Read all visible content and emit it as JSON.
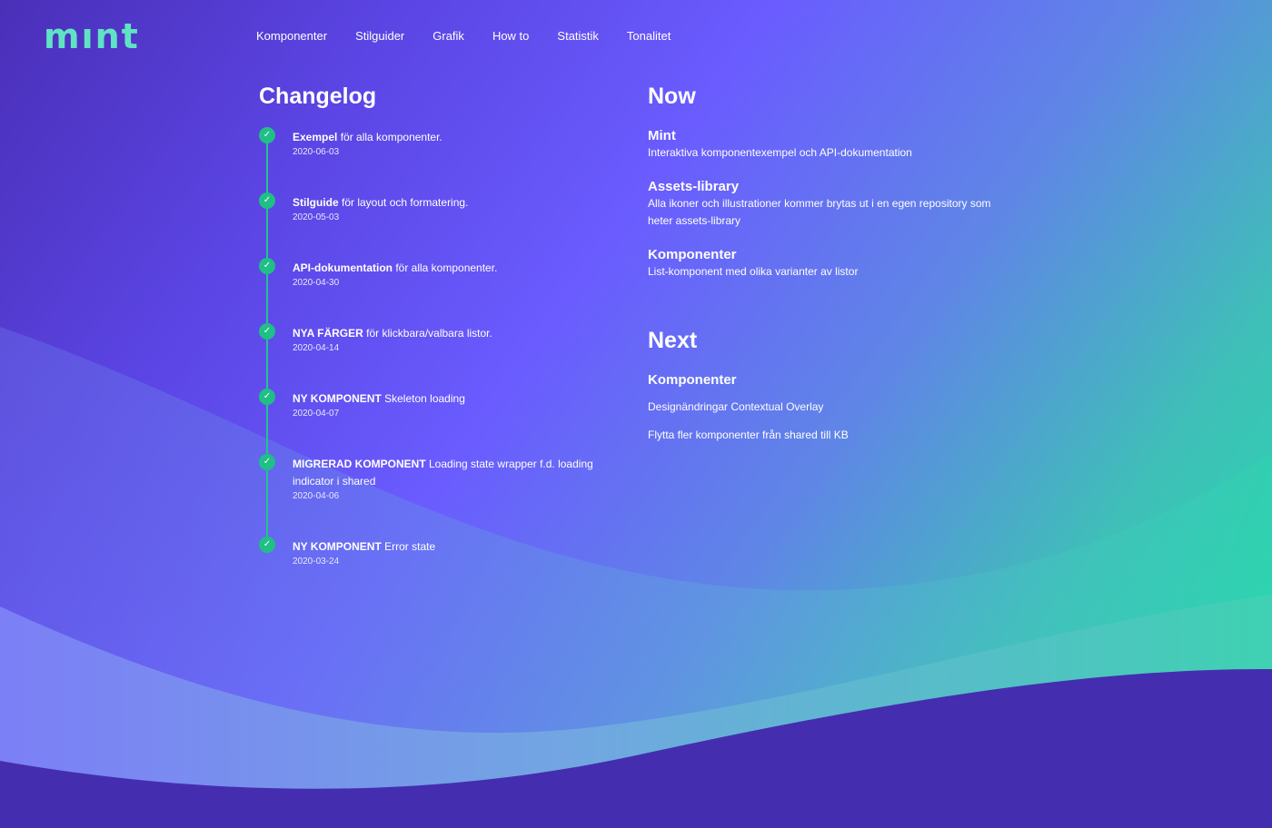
{
  "brand": {
    "logo_text": "mınt",
    "logo_color": "#5fe3c4"
  },
  "nav": {
    "items": [
      "Komponenter",
      "Stilguider",
      "Grafik",
      "How to",
      "Statistik",
      "Tonalitet"
    ]
  },
  "changelog": {
    "title": "Changelog",
    "items": [
      {
        "bold": "Exempel",
        "text": " för alla komponenter.",
        "date": "2020-06-03"
      },
      {
        "bold": "Stilguide",
        "text": " för layout och formatering.",
        "date": "2020-05-03"
      },
      {
        "bold": "API-dokumentation",
        "text": " för alla komponenter.",
        "date": "2020-04-30"
      },
      {
        "bold": "NYA FÄRGER",
        "text": " för klickbara/valbara listor.",
        "date": "2020-04-14"
      },
      {
        "bold": "NY KOMPONENT",
        "text": " Skeleton loading",
        "date": "2020-04-07"
      },
      {
        "bold": "MIGRERAD KOMPONENT",
        "text": " Loading state wrapper f.d. loading indicator i shared",
        "date": "2020-04-06"
      },
      {
        "bold": "NY KOMPONENT",
        "text": " Error state",
        "date": "2020-03-24"
      }
    ]
  },
  "now": {
    "title": "Now",
    "items": [
      {
        "title": "Mint",
        "desc": "Interaktiva komponentexempel och API-dokumentation"
      },
      {
        "title": "Assets-library",
        "desc": "Alla ikoner och illustrationer kommer brytas ut i en egen repository som heter assets-library"
      },
      {
        "title": "Komponenter",
        "desc": "List-komponent med olika varianter av listor"
      }
    ]
  },
  "next": {
    "title": "Next",
    "subtitle": "Komponenter",
    "items": [
      "Designändringar Contextual Overlay",
      "Flytta fler komponenter från shared till KB"
    ]
  },
  "colors": {
    "accent_green": "#1fbf86",
    "background_purple": "#6a5cff",
    "wave_dark": "#442eaf",
    "wave_light": "#7d7ff5"
  }
}
